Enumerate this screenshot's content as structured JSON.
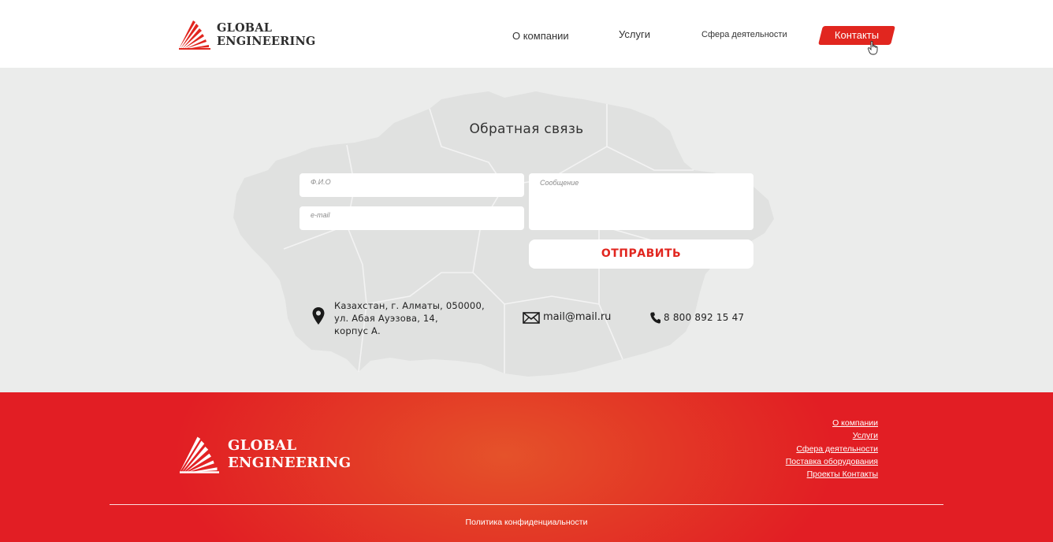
{
  "header": {
    "logo_line1": "GLOBAL",
    "logo_line2": "ENGINEERING",
    "nav": {
      "about": "О компании",
      "services": "Услуги",
      "sphere": "Сфера деятельности",
      "contacts": "Контакты"
    }
  },
  "contact": {
    "title": "Обратная связь",
    "form": {
      "name_placeholder": "Ф.И.О",
      "email_placeholder": "e-mail",
      "message_placeholder": "Сообщение",
      "submit_label": "ОТПРАВИТЬ"
    },
    "address_line1": "Казахстан, г. Алматы, 050000,",
    "address_line2": "ул. Абая Ауэзова, 14,",
    "address_line3": "корпус А.",
    "email": "mail@mail.ru",
    "phone": "8 800 892 15 47"
  },
  "footer": {
    "logo_line1": "GLOBAL",
    "logo_line2": "ENGINEERING",
    "links": [
      "О компании",
      "Услуги",
      "Сфера деятельности",
      "Поставка оборудования",
      "Проекты Контакты"
    ],
    "privacy": "Политика конфиденциальности"
  },
  "colors": {
    "accent": "#e1261f",
    "section_bg": "#ebeceb",
    "map_fill": "#e0e1e0"
  },
  "icons": [
    "logo-rays-icon",
    "hand-cursor-icon",
    "location-pin-icon",
    "envelope-icon",
    "phone-icon"
  ]
}
